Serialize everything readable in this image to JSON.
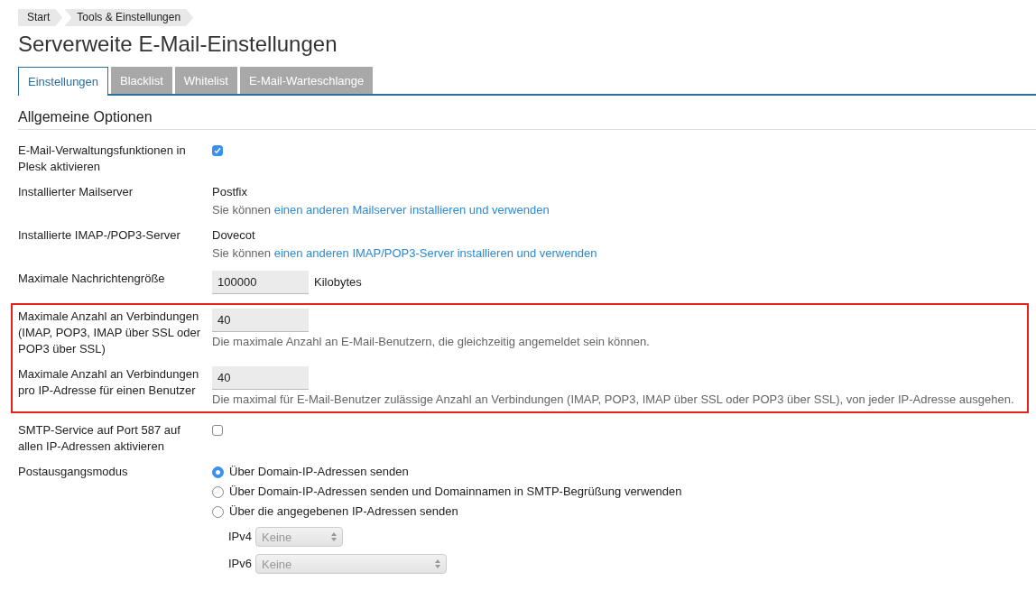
{
  "breadcrumb": [
    "Start",
    "Tools & Einstellungen"
  ],
  "title": "Serverweite E-Mail-Einstellungen",
  "tabs": [
    {
      "label": "Einstellungen",
      "selected": true
    },
    {
      "label": "Blacklist",
      "selected": false
    },
    {
      "label": "Whitelist",
      "selected": false
    },
    {
      "label": "E-Mail-Warteschlange",
      "selected": false
    }
  ],
  "section": "Allgemeine Optionen",
  "rows": [
    {
      "kind": "checkbox",
      "label": "E-Mail-Verwaltungsfunktionen in Plesk aktivieren",
      "checked": true,
      "highlighted": false
    },
    {
      "kind": "info",
      "label": "Installierter Mailserver",
      "value": "Postfix",
      "hint": "Sie können",
      "link": "einen anderen Mailserver installieren und verwenden",
      "highlighted": false
    },
    {
      "kind": "info",
      "label": "Installierte IMAP-/POP3-Server",
      "value": "Dovecot",
      "hint": "Sie können",
      "link": "einen anderen IMAP/POP3-Server installieren und verwenden",
      "highlighted": false
    },
    {
      "kind": "input",
      "label": "Maximale Nachrichtengröße",
      "value": "100000",
      "unit": "Kilobytes",
      "highlighted": false
    },
    {
      "kind": "input",
      "label": "Maximale Anzahl an Verbindungen (IMAP, POP3, IMAP über SSL oder POP3 über SSL)",
      "value": "40",
      "hint": "Die maximale Anzahl an E-Mail-Benutzern, die gleichzeitig angemeldet sein können.",
      "highlighted": true
    },
    {
      "kind": "input",
      "label": "Maximale Anzahl an Verbindungen pro IP-Adresse für einen Benutzer",
      "value": "40",
      "hint": "Die maximal für E-Mail-Benutzer zulässige Anzahl an Verbindungen (IMAP, POP3, IMAP über SSL oder POP3 über SSL), von jeder IP-Adresse ausgehen.",
      "highlighted": true
    },
    {
      "kind": "checkbox",
      "label": "SMTP-Service auf Port 587 auf allen IP-Adressen aktivieren",
      "checked": false,
      "highlighted": false
    },
    {
      "kind": "radio",
      "label": "Postausgangsmodus",
      "highlighted": false,
      "options": [
        {
          "label": "Über Domain-IP-Adressen senden",
          "selected": true
        },
        {
          "label": "Über Domain-IP-Adressen senden und Domainnamen in SMTP-Begrüßung verwenden",
          "selected": false
        },
        {
          "label": "Über die angegebenen IP-Adressen senden",
          "selected": false
        }
      ],
      "selects": [
        {
          "label": "IPv4",
          "value": "Keine",
          "disabled": true,
          "wide": false
        },
        {
          "label": "IPv6",
          "value": "Keine",
          "disabled": true,
          "wide": true
        }
      ]
    }
  ]
}
